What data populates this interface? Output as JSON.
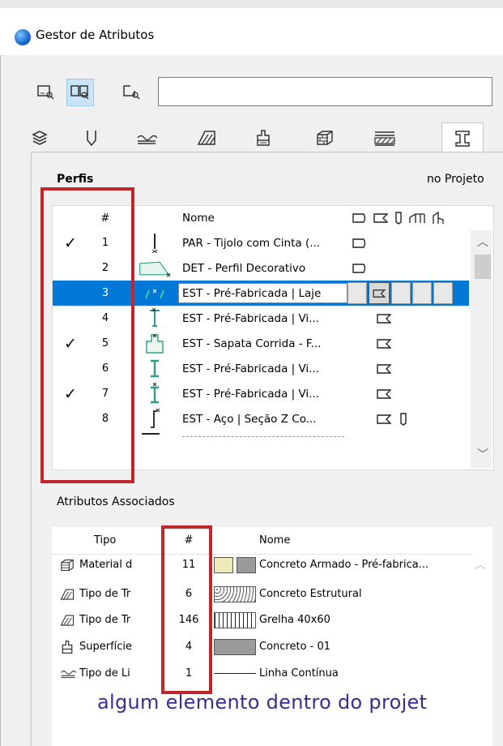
{
  "window": {
    "title": "Gestor de Atributos"
  },
  "search": {
    "value": ""
  },
  "section1": {
    "title": "Perfis",
    "scope": "no Projeto"
  },
  "list_header": {
    "num": "#",
    "name": "Nome"
  },
  "profiles": [
    {
      "checked": "✓",
      "num": "1",
      "name": "PAR - Tijolo com Cinta (..."
    },
    {
      "checked": "",
      "num": "2",
      "name": "DET - Perfil Decorativo"
    },
    {
      "checked": "",
      "num": "3",
      "name": "EST - Pré-Fabricada | Laje"
    },
    {
      "checked": "",
      "num": "4",
      "name": "EST - Pré-Fabricada | Vi..."
    },
    {
      "checked": "✓",
      "num": "5",
      "name": "EST - Sapata Corrida - F..."
    },
    {
      "checked": "",
      "num": "6",
      "name": "EST - Pré-Fabricada | Vi..."
    },
    {
      "checked": "✓",
      "num": "7",
      "name": "EST - Pré-Fabricada | Vi..."
    },
    {
      "checked": "",
      "num": "8",
      "name": "EST - Aço | Seção Z Co..."
    }
  ],
  "section2": {
    "title": "Atributos Associados"
  },
  "assoc_header": {
    "tipo": "Tipo",
    "num": "#",
    "name": "Nome"
  },
  "associated": [
    {
      "tipo": "Material d",
      "num": "11",
      "name": "Concreto Armado - Pré-fabrica..."
    },
    {
      "tipo": "Tipo de Tr",
      "num": "6",
      "name": "Concreto Estrutural"
    },
    {
      "tipo": "Tipo de Tr",
      "num": "146",
      "name": "Grelha 40x60"
    },
    {
      "tipo": "Superfície",
      "num": "4",
      "name": "Concreto - 01"
    },
    {
      "tipo": "Tipo de Li",
      "num": "1",
      "name": "Linha Contínua"
    }
  ],
  "caption": "algum elemento dentro do projet",
  "colors": {
    "selection": "#0078d7",
    "highlight_box": "#c0262b",
    "caption": "#3b2d8f"
  }
}
